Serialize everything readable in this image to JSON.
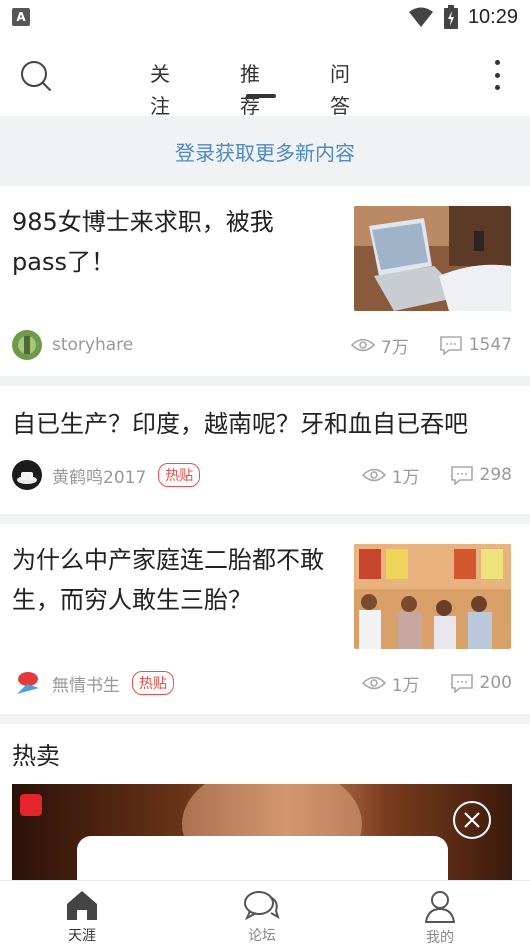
{
  "status_bar": {
    "time": "10:29",
    "notification_icon": "A"
  },
  "top_nav": {
    "tabs": [
      {
        "label": "关注",
        "active": false
      },
      {
        "label": "推荐",
        "active": true
      },
      {
        "label": "问答",
        "active": false
      }
    ]
  },
  "login_banner": {
    "text": "登录获取更多新内容"
  },
  "feed": [
    {
      "title": "985女博士来求职，被我pass了！",
      "author": "storyhare",
      "hot": false,
      "views": "7万",
      "comments": "1547",
      "has_image": true
    },
    {
      "title": "自已生产？印度，越南呢？牙和血自已吞吧",
      "author": "黄鹤鸣2017",
      "hot": true,
      "hot_label": "热贴",
      "views": "1万",
      "comments": "298",
      "has_image": false
    },
    {
      "title": "为什么中产家庭连二胎都不敢生，而穷人敢生三胎？",
      "author": "無情书生",
      "hot": true,
      "hot_label": "热贴",
      "views": "1万",
      "comments": "200",
      "has_image": true
    }
  ],
  "hot_section": {
    "title": "热卖"
  },
  "bottom_nav": {
    "items": [
      {
        "label": "天涯",
        "icon": "home-icon",
        "active": true
      },
      {
        "label": "论坛",
        "icon": "chat-bubbles-icon",
        "active": false
      },
      {
        "label": "我的",
        "icon": "person-icon",
        "active": false
      }
    ]
  },
  "colors": {
    "accent_link": "#4d8ac7",
    "hot_badge": "#e8504a",
    "divider": "#f1f2f4"
  }
}
